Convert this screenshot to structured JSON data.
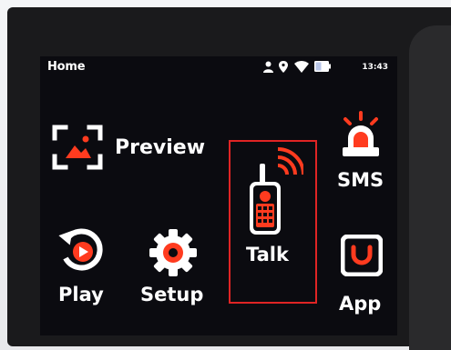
{
  "status_bar": {
    "title": "Home",
    "time": "13:43",
    "icons": [
      "user-icon",
      "location-icon",
      "wifi-icon",
      "battery-icon"
    ]
  },
  "tiles": {
    "preview": {
      "label": "Preview",
      "icon": "preview-icon"
    },
    "play": {
      "label": "Play",
      "icon": "replay-icon"
    },
    "setup": {
      "label": "Setup",
      "icon": "gear-icon"
    },
    "talk": {
      "label": "Talk",
      "icon": "walkie-talkie-icon",
      "selected": true
    },
    "sms": {
      "label": "SMS",
      "icon": "alarm-beacon-icon"
    },
    "app": {
      "label": "App",
      "icon": "app-icon"
    }
  },
  "colors": {
    "accent": "#ff3b1f",
    "selection": "#e02424",
    "text": "#ffffff",
    "screen_bg": "#0b0b10"
  }
}
